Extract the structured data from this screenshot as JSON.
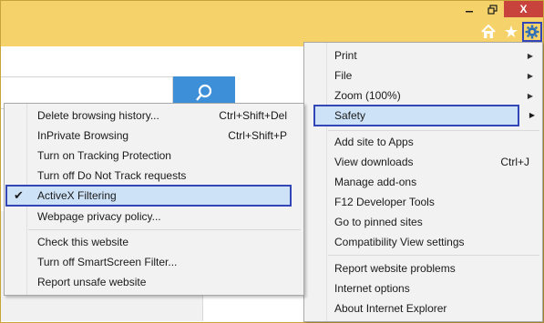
{
  "colors": {
    "titlebar": "#f6d36a",
    "close": "#c9433d",
    "highlight_border": "#3346b8",
    "highlight_fill": "#cde2f7",
    "search_button": "#3d8fd8"
  },
  "window": {
    "minimize_icon": "minimize-icon",
    "maximize_icon": "maximize-icon",
    "close_label": "X"
  },
  "toolbar": {
    "home_icon": "home-icon",
    "favorites_icon": "star-icon",
    "tools_icon": "gear-icon"
  },
  "search": {
    "button_icon": "magnifier-icon",
    "value": ""
  },
  "tools_menu": {
    "items": [
      {
        "label": "Print",
        "shortcut": "",
        "submenu": true
      },
      {
        "label": "File",
        "shortcut": "",
        "submenu": true
      },
      {
        "label": "Zoom (100%)",
        "shortcut": "",
        "submenu": true
      },
      {
        "label": "Safety",
        "shortcut": "",
        "submenu": true,
        "highlighted": true
      },
      {
        "label": "Add site to Apps",
        "shortcut": ""
      },
      {
        "label": "View downloads",
        "shortcut": "Ctrl+J"
      },
      {
        "label": "Manage add-ons",
        "shortcut": ""
      },
      {
        "label": "F12 Developer Tools",
        "shortcut": ""
      },
      {
        "label": "Go to pinned sites",
        "shortcut": ""
      },
      {
        "label": "Compatibility View settings",
        "shortcut": ""
      },
      {
        "label": "Report website problems",
        "shortcut": ""
      },
      {
        "label": "Internet options",
        "shortcut": ""
      },
      {
        "label": "About Internet Explorer",
        "shortcut": ""
      }
    ]
  },
  "safety_menu": {
    "items": [
      {
        "label": "Delete browsing history...",
        "shortcut": "Ctrl+Shift+Del"
      },
      {
        "label": "InPrivate Browsing",
        "shortcut": "Ctrl+Shift+P"
      },
      {
        "label": "Turn on Tracking Protection",
        "shortcut": ""
      },
      {
        "label": "Turn off Do Not Track requests",
        "shortcut": ""
      },
      {
        "label": "ActiveX Filtering",
        "shortcut": "",
        "checked": true,
        "highlighted": true
      },
      {
        "label": "Webpage privacy policy...",
        "shortcut": ""
      },
      {
        "label": "Check this website",
        "shortcut": ""
      },
      {
        "label": "Turn off SmartScreen Filter...",
        "shortcut": ""
      },
      {
        "label": "Report unsafe website",
        "shortcut": ""
      }
    ]
  }
}
